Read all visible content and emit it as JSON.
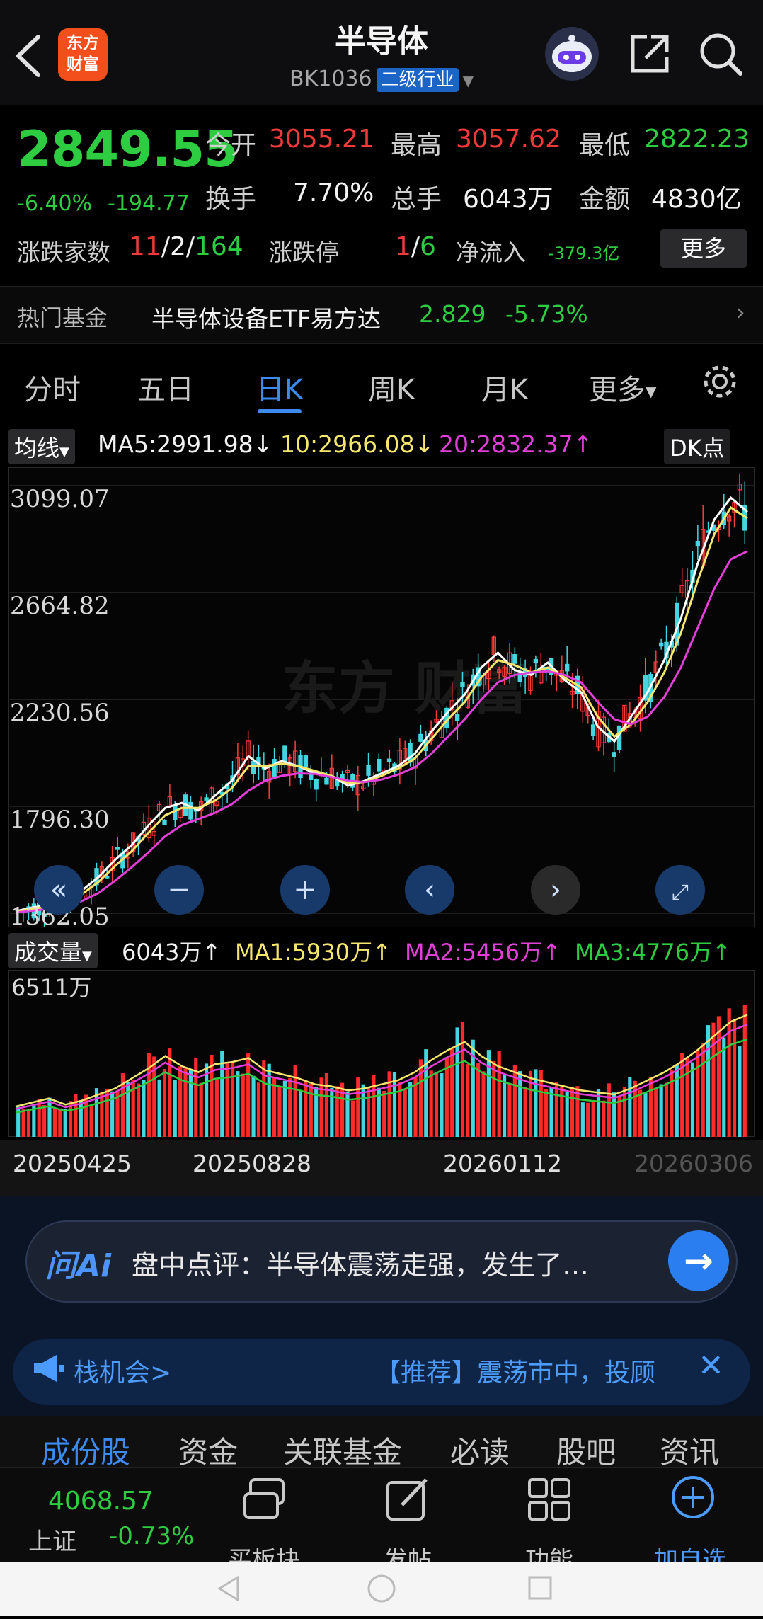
{
  "header": {
    "title": "半导体",
    "code": "BK1036",
    "badge": "二级行业",
    "logo_text": "东方\n财富"
  },
  "quote": {
    "price": "2849.55",
    "change_pct": "-6.40%",
    "change": "-194.77",
    "open_label": "今开",
    "open": "3055.21",
    "high_label": "最高",
    "high": "3057.62",
    "low_label": "最低",
    "low": "2822.23",
    "turnover_label": "换手",
    "turnover": "7.70%",
    "volume_label": "总手",
    "volume": "6043万",
    "amount_label": "金额",
    "amount": "4830亿",
    "breadth_label": "涨跌家数",
    "breadth_up": "11",
    "breadth_flat": "2",
    "breadth_down": "164",
    "limit_label": "涨跌停",
    "limit_up": "1",
    "limit_down": "6",
    "netflow_label": "净流入",
    "netflow": "-379.3亿",
    "more_label": "更多"
  },
  "fund": {
    "label": "热门基金",
    "name": "半导体设备ETF易方达",
    "price": "2.829",
    "change": "-5.73%"
  },
  "tabs": [
    "分时",
    "五日",
    "日K",
    "周K",
    "月K",
    "更多"
  ],
  "ma": {
    "button": "均线",
    "ma5": "MA5:2991.98↓",
    "ma10": "10:2966.08↓",
    "ma20": "20:2832.37↑",
    "dk": "DK点"
  },
  "chart_data": [
    {
      "type": "candlestick",
      "y_ticks": [
        "3099.07",
        "2664.82",
        "2230.56",
        "1796.30",
        "1362.05"
      ],
      "ylim": [
        1362.05,
        3099.07
      ],
      "x_ticks": [
        "20250425",
        "20250828",
        "20260112"
      ],
      "series": [
        {
          "name": "MA5",
          "color": "#ffffff",
          "values": [
            1370,
            1385,
            1395,
            1420,
            1455,
            1510,
            1580,
            1640,
            1720,
            1790,
            1810,
            1780,
            1840,
            1900,
            2000,
            1950,
            1980,
            1960,
            1930,
            1920,
            1880,
            1900,
            1930,
            1960,
            2010,
            2100,
            2180,
            2250,
            2360,
            2420,
            2350,
            2330,
            2380,
            2310,
            2260,
            2120,
            2060,
            2160,
            2260,
            2390,
            2560,
            2780,
            2960,
            3050,
            2991.98
          ]
        },
        {
          "name": "MA10",
          "color": "#f5e66e",
          "values": [
            1368,
            1380,
            1390,
            1410,
            1440,
            1490,
            1555,
            1615,
            1690,
            1760,
            1790,
            1790,
            1820,
            1870,
            1960,
            1960,
            1970,
            1960,
            1940,
            1920,
            1890,
            1895,
            1920,
            1950,
            1990,
            2070,
            2150,
            2220,
            2320,
            2390,
            2370,
            2340,
            2360,
            2320,
            2280,
            2160,
            2080,
            2130,
            2220,
            2340,
            2500,
            2710,
            2900,
            3010,
            2966.08
          ]
        },
        {
          "name": "MA20",
          "color": "#e23fd8",
          "values": [
            1365,
            1372,
            1380,
            1392,
            1412,
            1445,
            1495,
            1550,
            1610,
            1675,
            1720,
            1745,
            1770,
            1805,
            1860,
            1900,
            1920,
            1930,
            1928,
            1915,
            1900,
            1895,
            1905,
            1925,
            1955,
            2010,
            2080,
            2150,
            2230,
            2300,
            2330,
            2340,
            2345,
            2330,
            2300,
            2220,
            2150,
            2130,
            2160,
            2240,
            2360,
            2520,
            2680,
            2800,
            2832.37
          ]
        }
      ]
    },
    {
      "type": "bar",
      "y_ticks": [
        "6511万"
      ],
      "ylim": [
        0,
        6511
      ],
      "legend": {
        "button": "成交量",
        "vol": "6043万↑",
        "ma1": "MA1:5930万↑",
        "ma2": "MA2:5456万↑",
        "ma3": "MA3:4776万↑"
      },
      "series": [
        {
          "name": "成交量",
          "values": [
            1500,
            1700,
            1900,
            1600,
            1800,
            2100,
            2400,
            2900,
            3400,
            4000,
            3500,
            3200,
            3600,
            3700,
            3900,
            3300,
            3100,
            2900,
            2600,
            2500,
            2300,
            2400,
            2600,
            2800,
            3200,
            3800,
            4300,
            4700,
            4000,
            3500,
            3200,
            2900,
            2700,
            2500,
            2300,
            2200,
            2100,
            2400,
            2800,
            3200,
            3700,
            4300,
            5000,
            5700,
            6043
          ]
        }
      ]
    }
  ],
  "dates_right": "20260306",
  "ai": {
    "logo": "问Ai",
    "text": "盘中点评：半导体震荡走强，发生了…"
  },
  "promo": {
    "left": "栈机会>",
    "right": "【推荐】震荡市中，投顾"
  },
  "subtabs": [
    "成份股",
    "资金",
    "关联基金",
    "必读",
    "股吧",
    "资讯"
  ],
  "bottom": {
    "index_value": "4068.57",
    "index_name": "上证",
    "index_change": "-0.73%",
    "items": [
      "买板块",
      "发帖",
      "功能",
      "加自选"
    ]
  }
}
